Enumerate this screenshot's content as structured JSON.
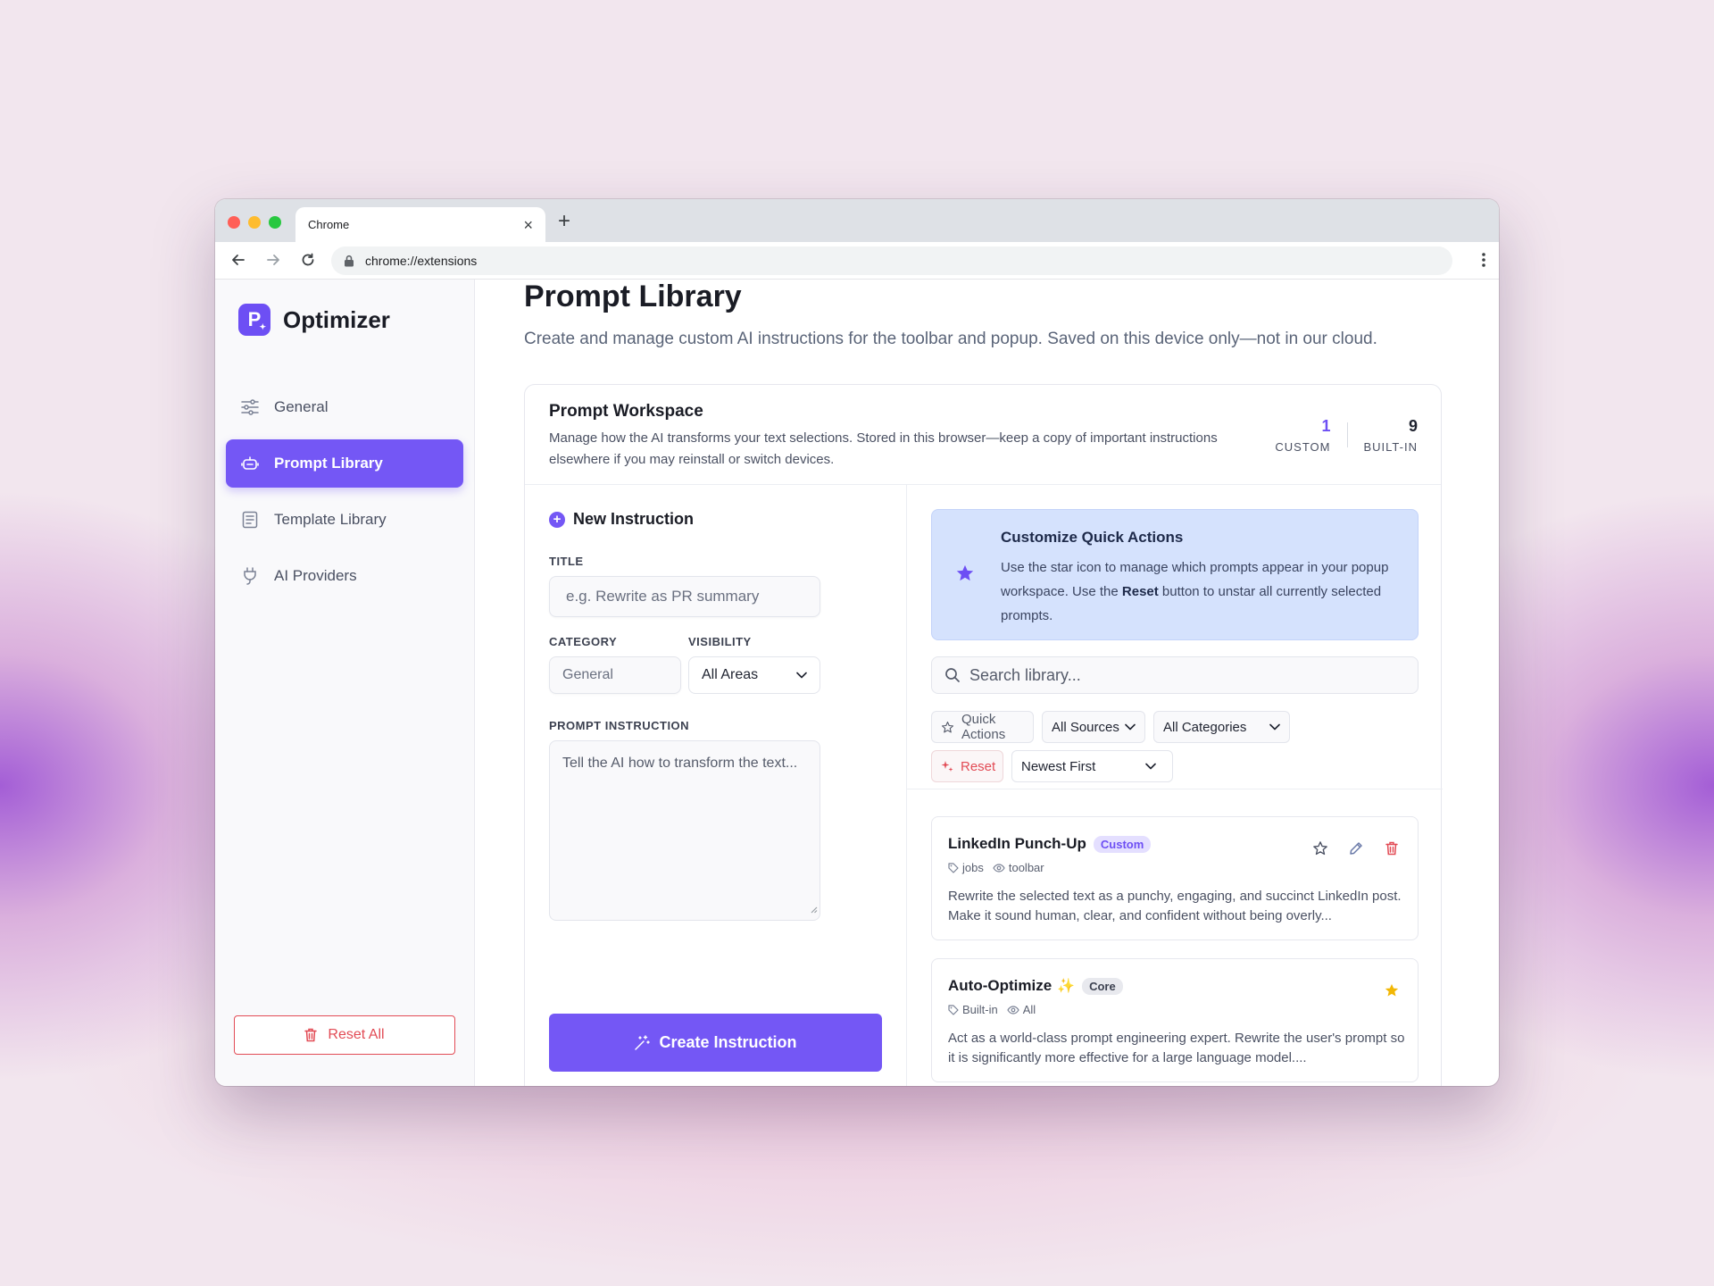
{
  "browser": {
    "tab_title": "Chrome",
    "tab_close": "×",
    "new_tab": "+",
    "url": "chrome://extensions"
  },
  "sidebar": {
    "brand": "Optimizer",
    "logo_letter": "P",
    "items": [
      {
        "label": "General",
        "icon": "sliders-icon"
      },
      {
        "label": "Prompt Library",
        "icon": "robot-icon",
        "active": true
      },
      {
        "label": "Template Library",
        "icon": "document-icon"
      },
      {
        "label": "AI Providers",
        "icon": "plug-icon"
      }
    ],
    "reset_all": "Reset All"
  },
  "page": {
    "title": "Prompt Library",
    "subtitle": "Create and manage custom AI instructions for the toolbar and popup. Saved on this device only—not in our cloud."
  },
  "workspace": {
    "title": "Prompt Workspace",
    "description": "Manage how the AI transforms your text selections. Stored in this browser—keep a copy of important instructions elsewhere if you may reinstall or switch devices.",
    "stats": {
      "custom_count": "1",
      "custom_label": "CUSTOM",
      "builtin_count": "9",
      "builtin_label": "BUILT-IN"
    }
  },
  "form": {
    "heading": "New Instruction",
    "title_label": "TITLE",
    "title_placeholder": "e.g. Rewrite as PR summary",
    "category_label": "CATEGORY",
    "category_value": "General",
    "visibility_label": "VISIBILITY",
    "visibility_value": "All Areas",
    "instruction_label": "PROMPT INSTRUCTION",
    "instruction_placeholder": "Tell the AI how to transform the text...",
    "create_button": "Create Instruction"
  },
  "quick_actions": {
    "title": "Customize Quick Actions",
    "text_1": "Use the star icon to manage which prompts appear in your popup workspace. Use the ",
    "text_bold": "Reset",
    "text_2": " button to unstar all currently selected prompts."
  },
  "filters": {
    "search_placeholder": "Search library...",
    "quick_actions": "Quick Actions",
    "sources": "All Sources",
    "categories": "All Categories",
    "reset": "Reset",
    "sort": "Newest First"
  },
  "prompts": [
    {
      "title": "LinkedIn Punch-Up",
      "badge": "Custom",
      "tag": "jobs",
      "visibility": "toolbar",
      "description": "Rewrite the selected text as a punchy, engaging, and succinct LinkedIn post. Make it sound human, clear, and confident without being overly...",
      "starred": false
    },
    {
      "title": "Auto-Optimize",
      "sparkle": "✨",
      "badge": "Core",
      "tag": "Built-in",
      "visibility": "All",
      "description": "Act as a world-class prompt engineering expert. Rewrite the user's prompt so it is significantly more effective for a large language model....",
      "starred": true
    }
  ],
  "colors": {
    "accent": "#7457f5",
    "danger": "#e24b55",
    "info_bg": "#d5e2fd",
    "star_gold": "#f2b705"
  }
}
